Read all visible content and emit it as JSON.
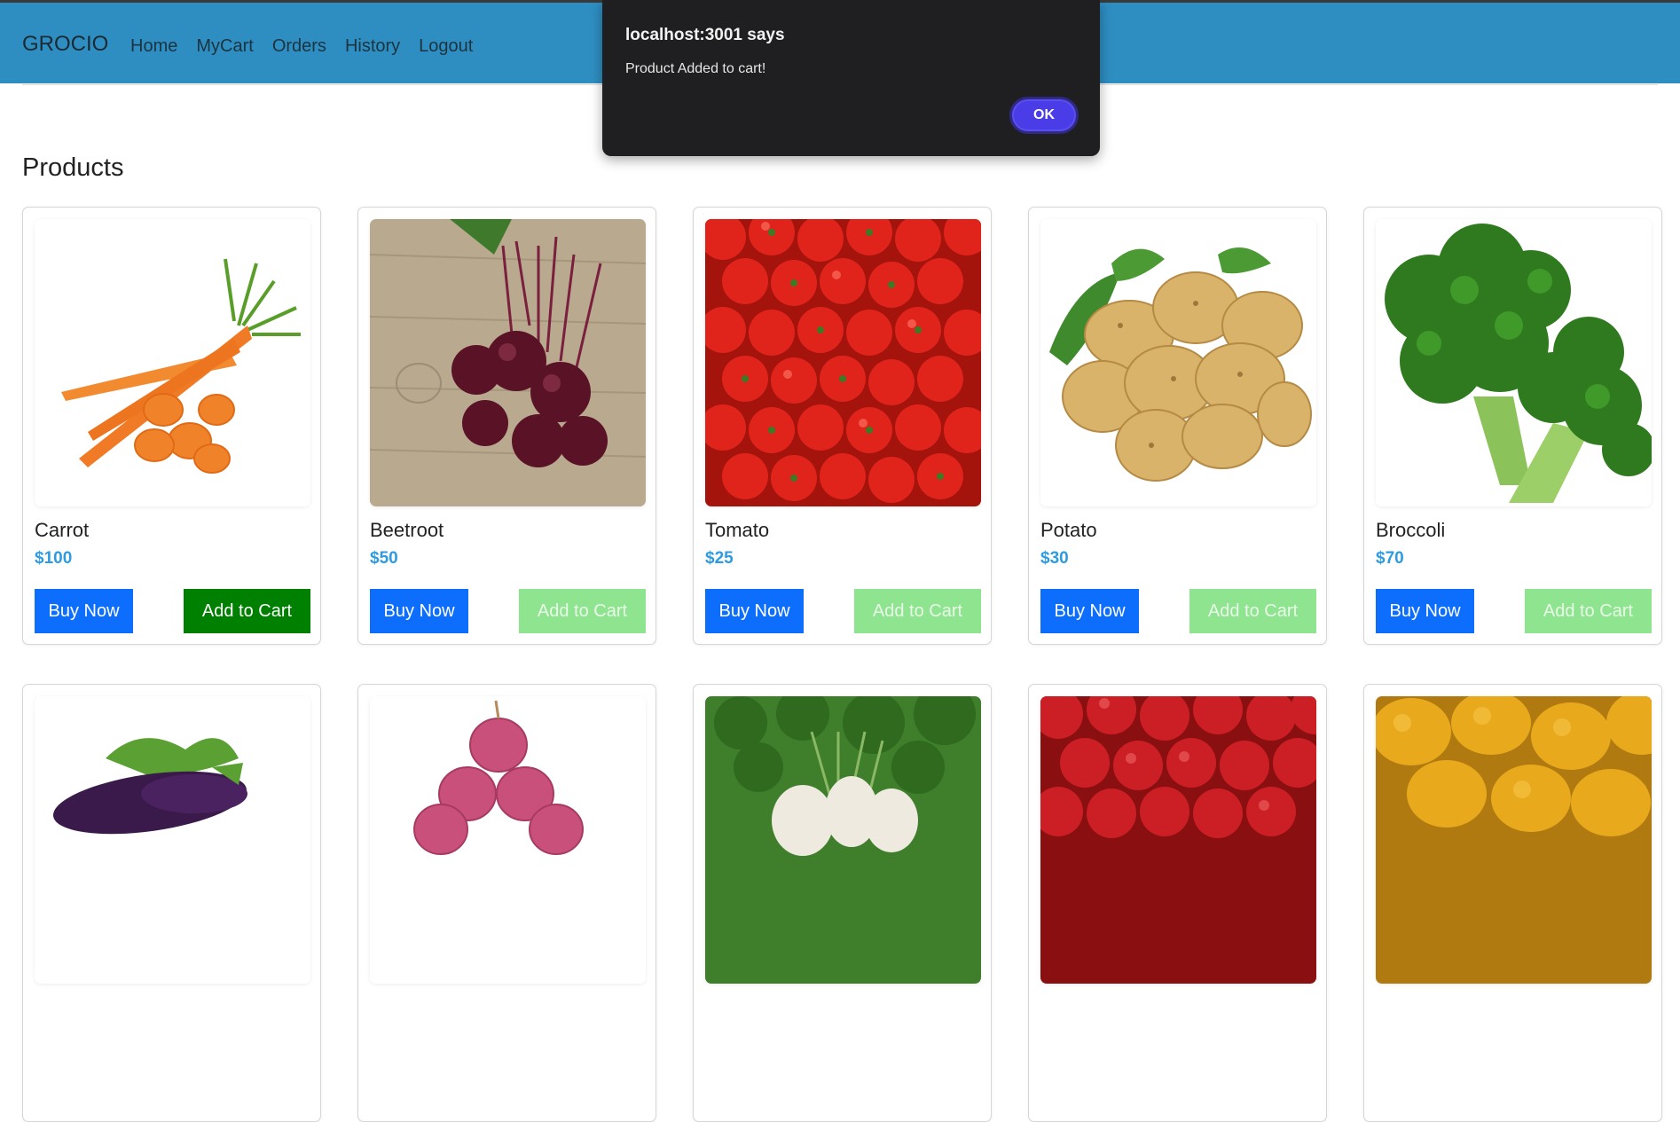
{
  "navbar": {
    "brand": "GROCIO",
    "links": [
      "Home",
      "MyCart",
      "Orders",
      "History",
      "Logout"
    ]
  },
  "page": {
    "title": "Products"
  },
  "products": [
    {
      "name": "Carrot",
      "price": "$100",
      "buy_label": "Buy Now",
      "cart_label": "Add to Cart",
      "image": "carrot"
    },
    {
      "name": "Beetroot",
      "price": "$50",
      "buy_label": "Buy Now",
      "cart_label": "Add to Cart",
      "image": "beetroot"
    },
    {
      "name": "Tomato",
      "price": "$25",
      "buy_label": "Buy Now",
      "cart_label": "Add to Cart",
      "image": "tomato"
    },
    {
      "name": "Potato",
      "price": "$30",
      "buy_label": "Buy Now",
      "cart_label": "Add to Cart",
      "image": "potato"
    },
    {
      "name": "Broccoli",
      "price": "$70",
      "buy_label": "Buy Now",
      "cart_label": "Add to Cart",
      "image": "broccoli"
    },
    {
      "image": "eggplant"
    },
    {
      "image": "onion"
    },
    {
      "image": "radish"
    },
    {
      "image": "apple"
    },
    {
      "image": "mango"
    }
  ],
  "dialog": {
    "title": "localhost:3001 says",
    "message": "Product Added to cart!",
    "ok_label": "OK"
  },
  "colors": {
    "navbar": "#2e8ec2",
    "buy_button": "#0d6efd",
    "add_to_cart_active": "#008000",
    "add_to_cart_disabled": "#8fe48f",
    "price": "#2e9be0"
  }
}
